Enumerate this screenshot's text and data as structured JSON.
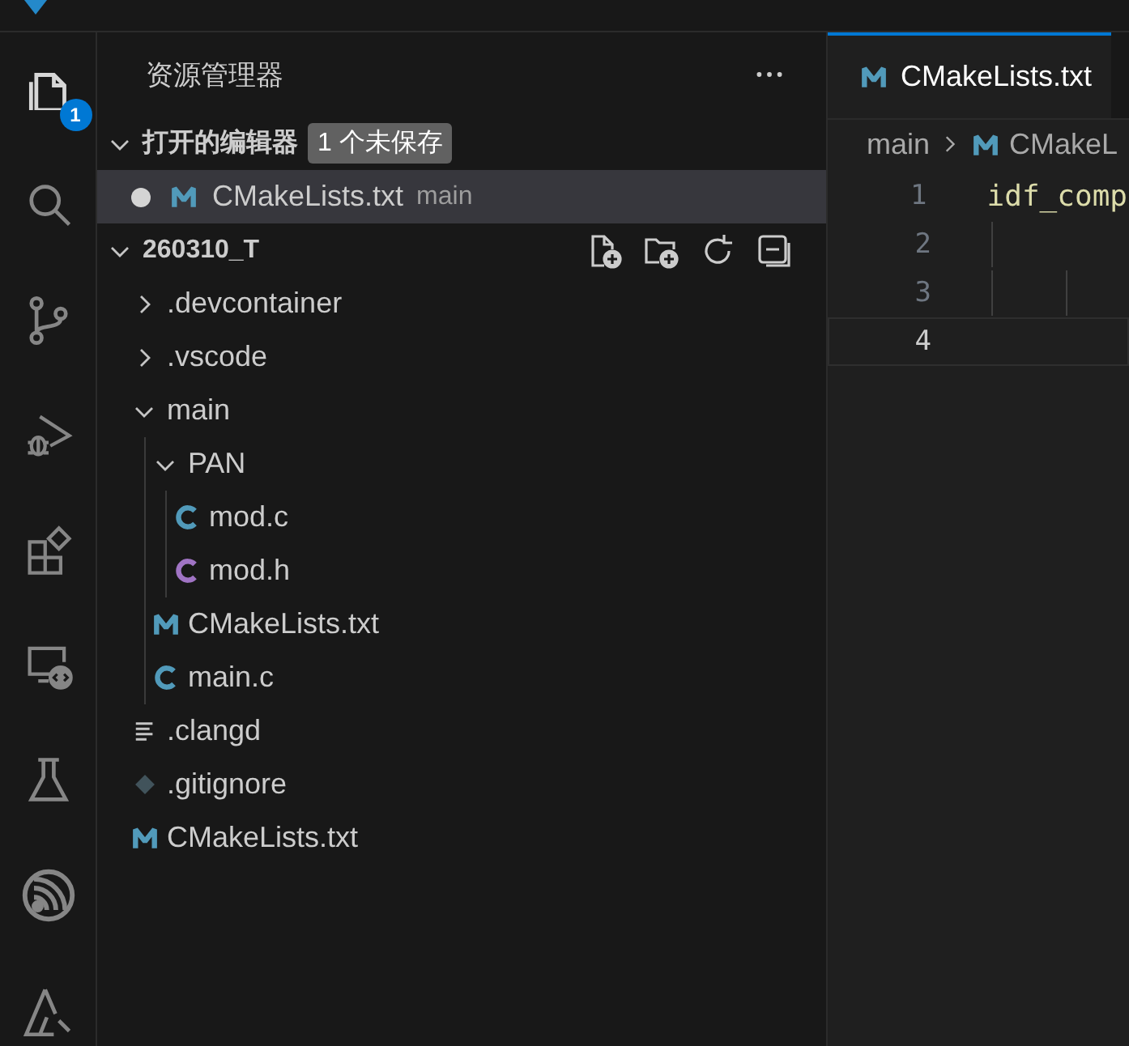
{
  "activity_bar": [
    {
      "kind": "explorer",
      "selected": true,
      "badge": "1"
    },
    {
      "kind": "search",
      "selected": false
    },
    {
      "kind": "source-control",
      "selected": false
    },
    {
      "kind": "debug",
      "selected": false
    },
    {
      "kind": "extensions",
      "selected": false
    },
    {
      "kind": "remote",
      "selected": false
    },
    {
      "kind": "testing",
      "selected": false
    },
    {
      "kind": "espressif",
      "selected": false
    },
    {
      "kind": "tools",
      "selected": false
    }
  ],
  "sidebar": {
    "title": "资源管理器",
    "open_editors": {
      "title": "打开的编辑器",
      "expanded": true,
      "badge": "1 个未保存",
      "items": [
        {
          "name": "CMakeLists.txt",
          "folder": "main",
          "kind": "cmake",
          "dirty": true,
          "selected": true
        }
      ]
    },
    "explorer": {
      "root": "260310_T",
      "expanded": true,
      "items": [
        {
          "name": ".devcontainer",
          "kind": "folder",
          "expanded": false
        },
        {
          "name": ".vscode",
          "kind": "folder",
          "expanded": false
        },
        {
          "name": "main",
          "kind": "folder",
          "expanded": true,
          "children": [
            {
              "name": "PAN",
              "kind": "folder",
              "expanded": true,
              "children": [
                {
                  "name": "mod.c",
                  "kind": "c"
                },
                {
                  "name": "mod.h",
                  "kind": "h"
                }
              ]
            },
            {
              "name": "CMakeLists.txt",
              "kind": "cmake"
            },
            {
              "name": "main.c",
              "kind": "c"
            }
          ]
        },
        {
          "name": ".clangd",
          "kind": "config"
        },
        {
          "name": ".gitignore",
          "kind": "git"
        },
        {
          "name": "CMakeLists.txt",
          "kind": "cmake"
        }
      ]
    }
  },
  "editor": {
    "tab": {
      "name": "CMakeLists.txt",
      "kind": "cmake",
      "selected": true
    },
    "breadcrumbs": [
      {
        "name": "main",
        "kind": "folder"
      },
      {
        "name": "CMakeL",
        "kind": "cmake"
      }
    ],
    "lines": [
      {
        "number": "1",
        "text": "idf_comp",
        "current": false
      },
      {
        "number": "2",
        "current": false
      },
      {
        "number": "3",
        "current": false
      },
      {
        "number": "4",
        "current": true
      }
    ]
  }
}
